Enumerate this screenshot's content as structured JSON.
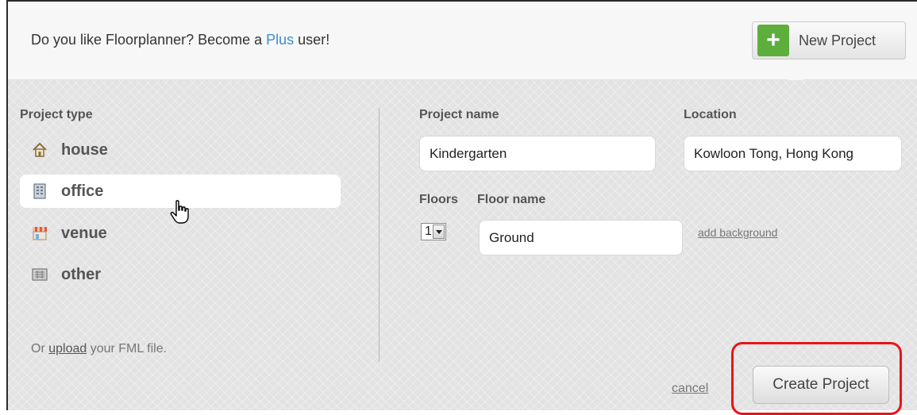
{
  "promo": {
    "prefix": "Do you like Floorplanner? Become a ",
    "link": "Plus",
    "suffix": " user!"
  },
  "header": {
    "new_project_icon": "+",
    "new_project_label": "New Project"
  },
  "project_type": {
    "heading": "Project type",
    "items": [
      {
        "label": "house",
        "icon": "house-icon",
        "selected": false
      },
      {
        "label": "office",
        "icon": "office-building-icon",
        "selected": true
      },
      {
        "label": "venue",
        "icon": "venue-storefront-icon",
        "selected": false
      },
      {
        "label": "other",
        "icon": "other-grid-icon",
        "selected": false
      }
    ],
    "upload_prefix": "Or ",
    "upload_link": "upload",
    "upload_suffix": " your FML file."
  },
  "form": {
    "project_name_label": "Project name",
    "project_name_value": "Kindergarten",
    "location_label": "Location",
    "location_value": "Kowloon Tong, Hong Kong",
    "floors_label": "Floors",
    "floors_value": "1",
    "floor_name_label": "Floor name",
    "floor_name_value": "Ground",
    "add_background_link": "add background"
  },
  "actions": {
    "cancel_link": "cancel",
    "create_label": "Create Project"
  },
  "colors": {
    "accent_green": "#5eae3e",
    "link_blue": "#3a8fc8",
    "highlight_red": "#e8141b"
  }
}
